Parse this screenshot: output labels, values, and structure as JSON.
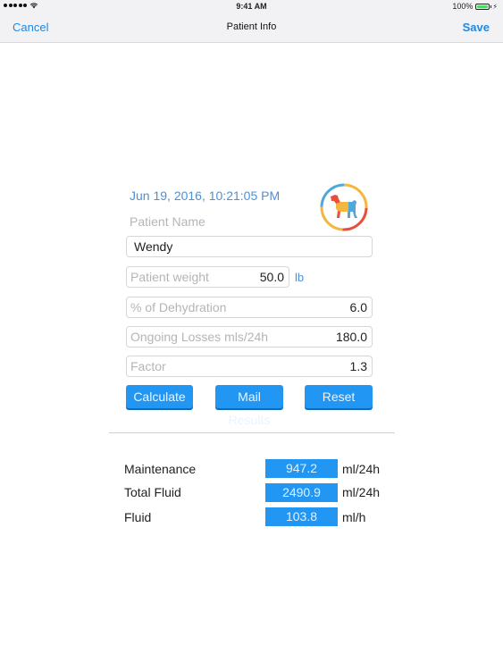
{
  "status": {
    "time": "9:41 AM",
    "battery": "100%"
  },
  "nav": {
    "cancel": "Cancel",
    "title": "Patient Info",
    "save": "Save"
  },
  "form": {
    "date": "Jun 19, 2016, 10:21:05 PM",
    "patient_name_label": "Patient Name",
    "patient_name": "Wendy",
    "weight_placeholder": "Patient weight",
    "weight_value": "50.0",
    "weight_unit": "lb",
    "dehydration_placeholder": "% of Dehydration",
    "dehydration_value": "6.0",
    "losses_placeholder": "Ongoing Losses mls/24h",
    "losses_value": "180.0",
    "factor_placeholder": "Factor",
    "factor_value": "1.3"
  },
  "buttons": {
    "calculate": "Calculate",
    "mail": "Mail Results",
    "reset": "Reset"
  },
  "results": [
    {
      "label": "Maintenance",
      "value": "947.2",
      "unit": "ml/24h"
    },
    {
      "label": "Total Fluid",
      "value": "2490.9",
      "unit": "ml/24h"
    },
    {
      "label": "Fluid",
      "value": "103.8",
      "unit": "ml/h"
    }
  ],
  "colors": {
    "accent": "#2196f3",
    "link": "#1e88e5",
    "date_text": "#4a90d9",
    "placeholder": "#b5b5b5"
  },
  "icons": {
    "logo": "dog-logo-icon"
  }
}
